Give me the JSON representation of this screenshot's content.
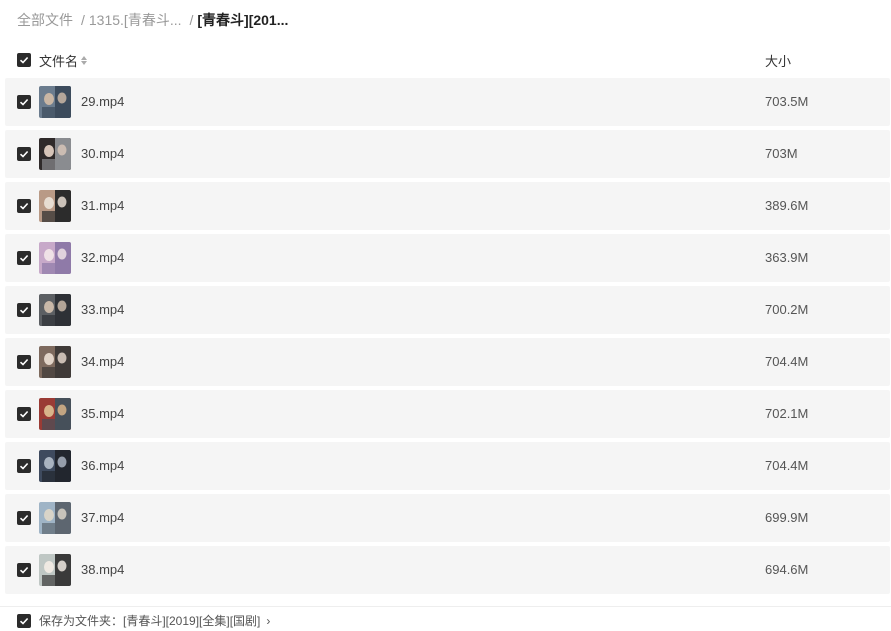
{
  "breadcrumb": [
    {
      "label": "全部文件"
    },
    {
      "label": "1315.[青春斗..."
    },
    {
      "label": "[青春斗][201..."
    }
  ],
  "header": {
    "name_label": "文件名",
    "size_label": "大小"
  },
  "files": [
    {
      "name": "29.mp4",
      "size": "703.5M",
      "thumb_colors": [
        "#6b7c8e",
        "#c9b6a4",
        "#3c4b5c"
      ]
    },
    {
      "name": "30.mp4",
      "size": "703M",
      "thumb_colors": [
        "#2f2a2a",
        "#d6c4b8",
        "#8a8c90"
      ]
    },
    {
      "name": "31.mp4",
      "size": "389.6M",
      "thumb_colors": [
        "#b99a86",
        "#e7ddd2",
        "#2c2c2c"
      ]
    },
    {
      "name": "32.mp4",
      "size": "363.9M",
      "thumb_colors": [
        "#c7a9c9",
        "#efe2e6",
        "#8f7aa8"
      ]
    },
    {
      "name": "33.mp4",
      "size": "700.2M",
      "thumb_colors": [
        "#5c5f63",
        "#c9b8a8",
        "#2e3136"
      ]
    },
    {
      "name": "34.mp4",
      "size": "704.4M",
      "thumb_colors": [
        "#7e6a5e",
        "#e2d4c8",
        "#3f3a38"
      ]
    },
    {
      "name": "35.mp4",
      "size": "702.1M",
      "thumb_colors": [
        "#9a3b35",
        "#d8b48a",
        "#46505a"
      ]
    },
    {
      "name": "36.mp4",
      "size": "704.4M",
      "thumb_colors": [
        "#3e4a5e",
        "#a9b3c0",
        "#22262e"
      ]
    },
    {
      "name": "37.mp4",
      "size": "699.9M",
      "thumb_colors": [
        "#9fb4c6",
        "#d9d4c8",
        "#5d6670"
      ]
    },
    {
      "name": "38.mp4",
      "size": "694.6M",
      "thumb_colors": [
        "#bfc7c4",
        "#efe9e2",
        "#3a3a3a"
      ]
    }
  ],
  "footer": {
    "save_label": "保存为文件夹：[青春斗][2019][全集][国剧]"
  },
  "colors": {
    "row_bg": "#f5f5f5",
    "checkbox": "#2b2b2b"
  },
  "icons": {
    "checkbox": "checkbox-checked-icon",
    "sort": "sort-icon",
    "chevron": "chevron-right-icon"
  }
}
